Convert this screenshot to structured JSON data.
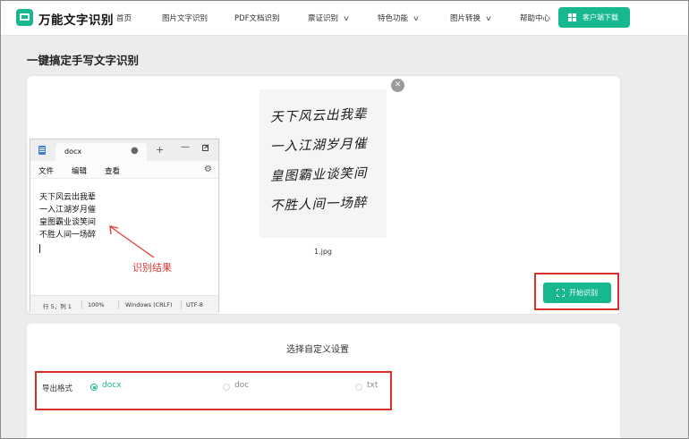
{
  "nav": {
    "brand": "万能文字识别",
    "items": [
      {
        "label": "首页",
        "has_dropdown": false
      },
      {
        "label": "图片文字识别",
        "has_dropdown": false
      },
      {
        "label": "PDF文档识别",
        "has_dropdown": false
      },
      {
        "label": "票证识别",
        "has_dropdown": true
      },
      {
        "label": "特色功能",
        "has_dropdown": true
      },
      {
        "label": "图片转换",
        "has_dropdown": true
      },
      {
        "label": "帮助中心",
        "has_dropdown": false
      }
    ],
    "download_label": "客户端下载"
  },
  "page_title": "一键搞定手写文字识别",
  "notepad": {
    "tab_name": "docx",
    "menu": [
      "文件",
      "编辑",
      "查看"
    ],
    "lines": [
      "天下风云出我辈",
      "一入江湖岁月催",
      "皇图霸业谈笑间",
      "不胜人间一场醉"
    ],
    "status": {
      "position": "行 5，列 1",
      "zoom": "100%",
      "line_ending": "Windows (CRLF)",
      "encoding": "UTF-8"
    }
  },
  "annotation_label": "识别结果",
  "preview": {
    "handwriting_lines": [
      "天下风云出我辈",
      "一入江湖岁月催",
      "皇图霸业谈笑间",
      "不胜人间一场醉"
    ],
    "file_name": "1.jpg",
    "start_label": "开始识别"
  },
  "settings": {
    "title": "选择自定义设置",
    "export_label": "导出格式",
    "selected": "docx",
    "formats": [
      "docx",
      "doc",
      "txt"
    ]
  },
  "colors": {
    "accent": "#17b890",
    "highlight": "#d9302c"
  },
  "icons": [
    "logo-icon",
    "windows-icon",
    "chevron-down-icon",
    "notepad-app-icon",
    "close-icon",
    "plus-icon",
    "minimize-icon",
    "maximize-icon",
    "gear-icon",
    "scan-icon",
    "remove-icon",
    "arrow-icon"
  ]
}
